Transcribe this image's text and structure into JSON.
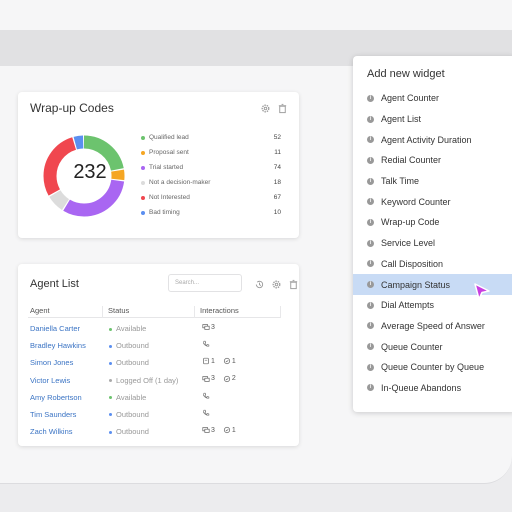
{
  "wrapup": {
    "title": "Wrap-up Codes",
    "total": "232",
    "legend": [
      {
        "label": "Qualified lead",
        "value": "52",
        "color": "#6cc36e"
      },
      {
        "label": "Proposal sent",
        "value": "11",
        "color": "#f5a623"
      },
      {
        "label": "Trial started",
        "value": "74",
        "color": "#a966f2"
      },
      {
        "label": "Not a decision-maker",
        "value": "18",
        "color": "#dcdcdc"
      },
      {
        "label": "Not Interested",
        "value": "67",
        "color": "#f0474f"
      },
      {
        "label": "Bad timing",
        "value": "10",
        "color": "#5b8ff0"
      }
    ]
  },
  "agents": {
    "title": "Agent List",
    "search_placeholder": "Search...",
    "headers": {
      "agent": "Agent",
      "status": "Status",
      "interactions": "Interactions"
    },
    "rows": [
      {
        "name": "Daniella Carter",
        "status": "Available",
        "status_color": "#6cc36e",
        "chat": "3",
        "phone": "",
        "sms": "",
        "msg": ""
      },
      {
        "name": "Bradley Hawkins",
        "status": "Outbound",
        "status_color": "#5b8ff0",
        "chat": "",
        "phone": "yes",
        "sms": "",
        "msg": ""
      },
      {
        "name": "Simon Jones",
        "status": "Outbound",
        "status_color": "#5b8ff0",
        "chat": "",
        "phone": "",
        "sms": "1",
        "msg": "1"
      },
      {
        "name": "Victor Lewis",
        "status": "Logged Off (1 day)",
        "status_color": "#aaaaaa",
        "chat": "3",
        "phone": "",
        "sms": "",
        "msg": "2"
      },
      {
        "name": "Amy Robertson",
        "status": "Available",
        "status_color": "#6cc36e",
        "chat": "",
        "phone": "yes",
        "sms": "",
        "msg": ""
      },
      {
        "name": "Tim Saunders",
        "status": "Outbound",
        "status_color": "#5b8ff0",
        "chat": "",
        "phone": "yes",
        "sms": "",
        "msg": ""
      },
      {
        "name": "Zach Wilkins",
        "status": "Outbound",
        "status_color": "#5b8ff0",
        "chat": "3",
        "phone": "",
        "sms": "",
        "msg": "1"
      }
    ]
  },
  "widget_panel": {
    "title": "Add new widget",
    "items": [
      "Agent Counter",
      "Agent List",
      "Agent Activity Duration",
      "Redial Counter",
      "Talk Time",
      "Keyword Counter",
      "Wrap-up Code",
      "Service Level",
      "Call Disposition",
      "Campaign Status",
      "Dial Attempts",
      "Average Speed of Answer",
      "Queue Counter",
      "Queue Counter by Queue",
      "In-Queue Abandons"
    ],
    "selected": "Campaign Status",
    "cursor_color": "#c83ee0"
  }
}
